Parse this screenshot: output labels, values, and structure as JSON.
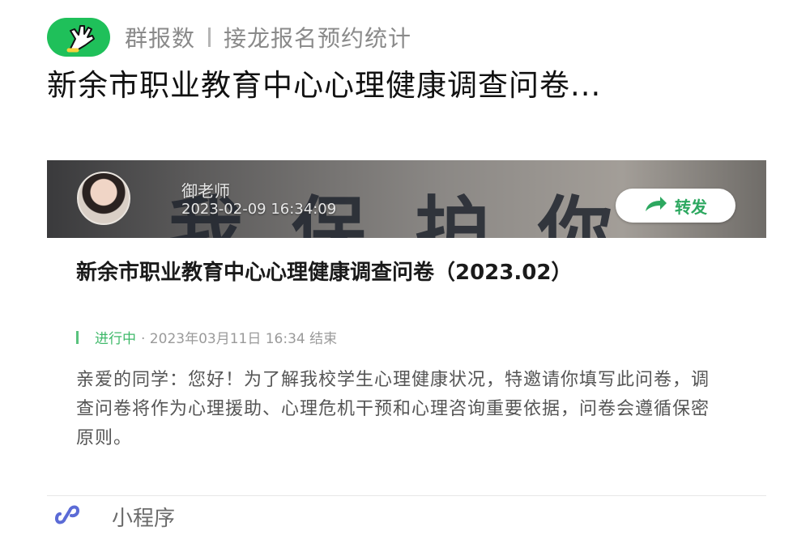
{
  "source": {
    "app_name": "群报数",
    "section": "接龙报名预约统计",
    "logo_icon": "hand-wave-logo-icon",
    "logo_color": "#1fc05a"
  },
  "main_title": "新余市职业教育中心心理健康调查问卷...",
  "preview": {
    "banner_text": "我保护你",
    "author": "御老师",
    "post_time": "2023-02-09 16:34:09",
    "forward_label": "转发",
    "forward_icon": "forward-arrow-icon",
    "survey_title": "新余市职业教育中心心理健康调查问卷（2023.02）",
    "status": "进行中",
    "deadline": "· 2023年03月11日 16:34 结束",
    "status_color": "#3fb96a",
    "description": "亲爱的同学：您好！为了解我校学生心理健康状况，特邀请你填写此问卷，调查问卷将作为心理援助、心理危机干预和心理咨询重要依据，问卷会遵循保密原则。"
  },
  "footer": {
    "label": "小程序",
    "icon": "mini-program-icon",
    "icon_color": "#5b6bd6"
  }
}
